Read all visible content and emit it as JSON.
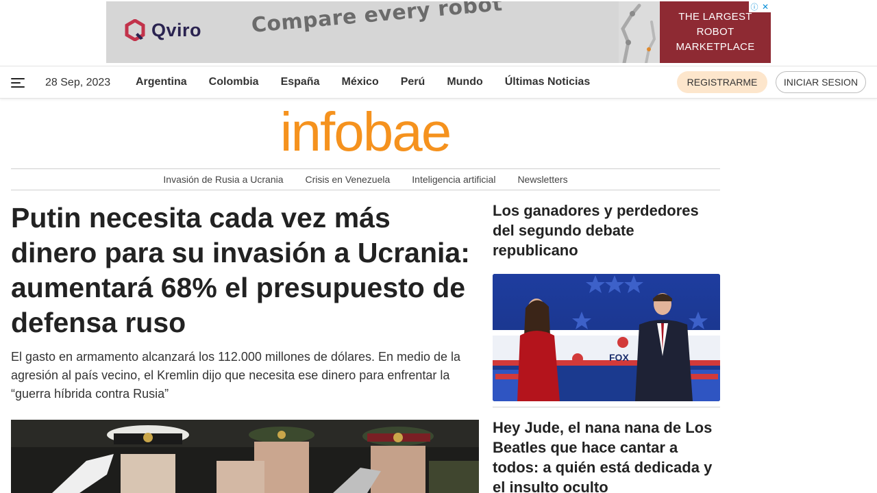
{
  "ad": {
    "brand": "Qviro",
    "tagline": "Compare every robot",
    "cta_lines": [
      "THE LARGEST",
      "ROBOT",
      "MARKETPLACE"
    ],
    "info_glyph": "ⓘ",
    "close_glyph": "✕",
    "colors": {
      "background": "#d6d6d6",
      "cta": "#8e2a33",
      "brand_text": "#2a2350"
    }
  },
  "nav": {
    "date": "28 Sep, 2023",
    "links": [
      "Argentina",
      "Colombia",
      "España",
      "México",
      "Perú",
      "Mundo",
      "Últimas Noticias"
    ],
    "register_label": "REGISTRARME",
    "login_label": "INICIAR SESION"
  },
  "logo": {
    "text": "infobae",
    "color": "#f5921e"
  },
  "topics": [
    "Invasión de Rusia a Ucrania",
    "Crisis en Venezuela",
    "Inteligencia artificial",
    "Newsletters"
  ],
  "main_story": {
    "headline": "Putin necesita cada vez más dinero para su invasión a Ucrania: aumentará 68% el presupuesto de defensa ruso",
    "deck": "El gasto en armamento alcanzará los 112.000 millones de dólares. En medio de la agresión al país vecino, el Kremlin dijo que necesita ese dinero para enfrentar la “guerra híbrida contra Rusia”"
  },
  "side_stories": [
    {
      "headline": "Los ganadores y perdedores del segundo debate republicano"
    },
    {
      "headline": "Hey Jude, el nana nana de Los Beatles que hace cantar a todos: a quién está dedicada y el insulto oculto"
    }
  ]
}
